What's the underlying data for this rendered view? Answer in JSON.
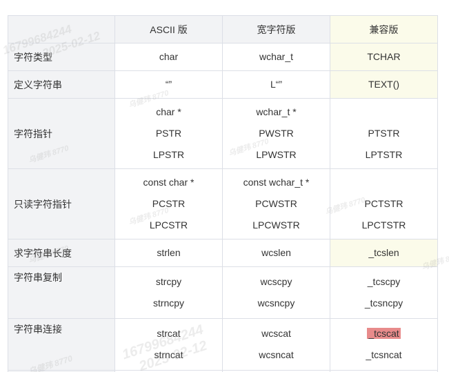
{
  "table": {
    "headers": [
      "",
      "ASCII 版",
      "宽字符版",
      "兼容版"
    ],
    "rows": [
      {
        "label": "字符类型",
        "ascii": [
          "char"
        ],
        "wide": [
          "wchar_t"
        ],
        "compat": [
          "TCHAR"
        ],
        "compat_highlight": true
      },
      {
        "label": "定义字符串",
        "ascii": [
          "“”"
        ],
        "wide": [
          "L“”"
        ],
        "compat": [
          "TEXT()"
        ],
        "compat_highlight": true
      },
      {
        "label": "字符指针",
        "ascii": [
          "char *",
          "PSTR",
          "LPSTR"
        ],
        "wide": [
          "wchar_t *",
          "PWSTR",
          "LPWSTR"
        ],
        "compat": [
          "",
          "PTSTR",
          "LPTSTR"
        ],
        "compat_highlight": false
      },
      {
        "label": "只读字符指针",
        "ascii": [
          "const char *",
          "PCSTR",
          "LPCSTR"
        ],
        "wide": [
          "const wchar_t *",
          "PCWSTR",
          "LPCWSTR"
        ],
        "compat": [
          "",
          "PCTSTR",
          "LPCTSTR"
        ],
        "compat_highlight": false
      },
      {
        "label": "求字符串长度",
        "ascii": [
          "strlen"
        ],
        "wide": [
          "wcslen"
        ],
        "compat": [
          "_tcslen"
        ],
        "compat_highlight": true
      },
      {
        "label": "字符串复制",
        "ascii": [
          "strcpy",
          "strncpy"
        ],
        "wide": [
          "wcscpy",
          "wcsncpy"
        ],
        "compat": [
          "_tcscpy",
          "_tcsncpy"
        ],
        "compat_highlight": false
      },
      {
        "label": "字符串连接",
        "ascii": [
          "strcat",
          "strncat"
        ],
        "wide": [
          "wcscat",
          "wcsncat"
        ],
        "compat": [
          "_tcscat",
          "_tcsncat"
        ],
        "compat_highlight": false,
        "marked": "_tcscat"
      }
    ]
  },
  "watermarks": [
    "16799684244",
    "乌健玮 8770",
    "2025-02-12"
  ]
}
